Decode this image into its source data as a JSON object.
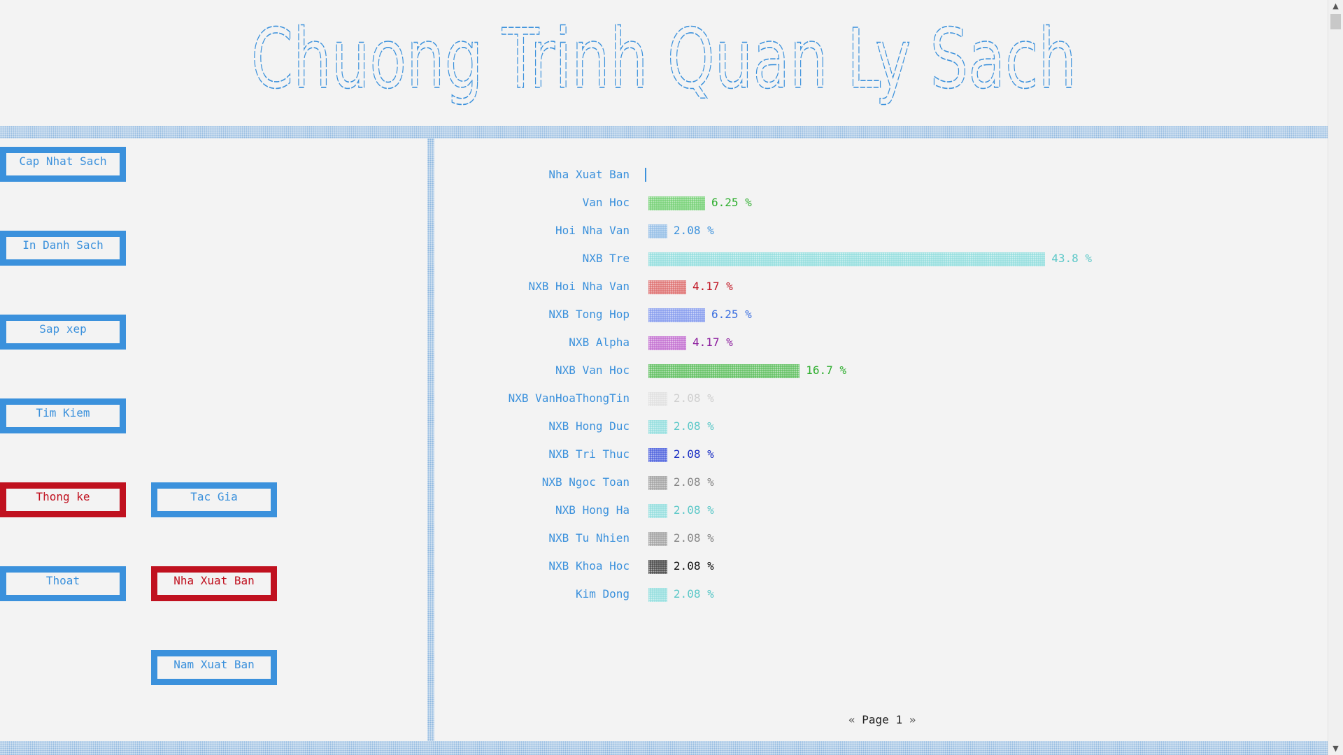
{
  "banner": {
    "title": "Chuong Trinh Quan Ly Sach",
    "color": "#3b91dc"
  },
  "menu": {
    "left": [
      {
        "label": "Cap Nhat Sach",
        "active": false
      },
      {
        "label": "In Danh Sach",
        "active": false
      },
      {
        "label": "Sap xep",
        "active": false
      },
      {
        "label": "Tim Kiem",
        "active": false
      },
      {
        "label": "Thong ke",
        "active": true
      },
      {
        "label": "Thoat",
        "active": false
      }
    ],
    "right": [
      {
        "label": "Tac Gia",
        "active": false
      },
      {
        "label": "Nha Xuat Ban",
        "active": true
      },
      {
        "label": "Nam Xuat Ban",
        "active": false
      }
    ]
  },
  "colors": {
    "accent": "#3b91dc",
    "active": "#c0111f"
  },
  "chart_data": {
    "type": "bar",
    "orientation": "horizontal",
    "header_label": "Nha Xuat Ban",
    "unit": "%",
    "categories": [
      "Van Hoc",
      "Hoi Nha Van",
      "NXB Tre",
      "NXB Hoi Nha Van",
      "NXB Tong Hop",
      "NXB Alpha",
      "NXB Van Hoc",
      "NXB VanHoaThongTin",
      "NXB Hong Duc",
      "NXB Tri Thuc",
      "NXB Ngoc Toan",
      "NXB Hong Ha",
      "NXB Tu Nhien",
      "NXB Khoa Hoc",
      "Kim Dong"
    ],
    "values": [
      6.25,
      2.08,
      43.8,
      4.17,
      6.25,
      4.17,
      16.7,
      2.08,
      2.08,
      2.08,
      2.08,
      2.08,
      2.08,
      2.08,
      2.08
    ],
    "value_labels": [
      "6.25 %",
      "2.08 %",
      "43.8 %",
      "4.17 %",
      "6.25 %",
      "4.17 %",
      "16.7 %",
      "2.08 %",
      "2.08 %",
      "2.08 %",
      "2.08 %",
      "2.08 %",
      "2.08 %",
      "2.08 %",
      "2.08 %"
    ],
    "bar_colors": [
      "#7fd47f",
      "#9cc3e8",
      "#9be0e0",
      "#e07a7a",
      "#8fa3ef",
      "#c77ad4",
      "#6cc46c",
      "#e2e2e2",
      "#9be0e0",
      "#5c6fe0",
      "#a9a9a9",
      "#9be0e0",
      "#a9a9a9",
      "#555555",
      "#9be0e0"
    ],
    "label_colors": [
      "#2eae2e",
      "#3b91dc",
      "#5cc8c8",
      "#c0111f",
      "#3b6fe0",
      "#8a1a9c",
      "#2eae2e",
      "#cfcfcf",
      "#5cc8c8",
      "#1a2fc4",
      "#888888",
      "#5cc8c8",
      "#888888",
      "#111111",
      "#5cc8c8"
    ]
  },
  "pager": {
    "prev": "«",
    "label": "Page",
    "page": "1",
    "next": "»"
  },
  "scrollbar": {
    "up": "▲",
    "down": "▼"
  }
}
